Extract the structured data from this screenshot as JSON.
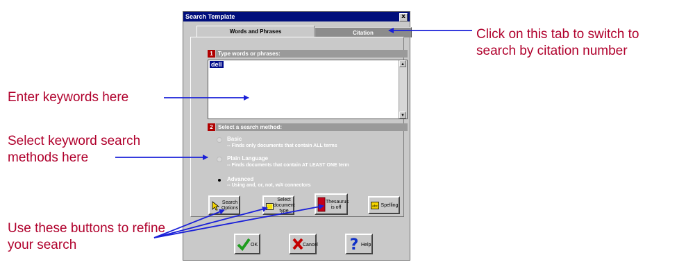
{
  "dialog": {
    "title": "Search Template",
    "close_glyph": "x",
    "tabs": [
      {
        "label": "Words and Phrases",
        "active": true
      },
      {
        "label": "Citation",
        "active": false
      }
    ],
    "section1": {
      "number": "1",
      "label": "Type words or phrases:",
      "value": "dell"
    },
    "section2": {
      "number": "2",
      "label": "Select a search method:"
    },
    "methods": [
      {
        "title": "Basic",
        "desc": "-- Finds only documents that contain ALL terms",
        "selected": false
      },
      {
        "title": "Plain Language",
        "desc": "-- Finds documents that contain AT LEAST ONE term",
        "selected": false
      },
      {
        "title": "Advanced",
        "desc": "-- Using and, or, not, w/# connectors",
        "selected": true
      }
    ],
    "tool_buttons": [
      {
        "label": "Search Options",
        "icon": "pointer-icon"
      },
      {
        "label": "Select document type",
        "icon": "document-icon"
      },
      {
        "label": "Thesaurus is off",
        "icon": "book-icon"
      },
      {
        "label": "Spelling",
        "icon": "abc-icon"
      }
    ],
    "action_buttons": [
      {
        "label": "OK",
        "icon": "check-icon"
      },
      {
        "label": "Cancel",
        "icon": "x-icon"
      },
      {
        "label": "Help",
        "icon": "question-icon"
      }
    ]
  },
  "annotations": {
    "citation_tab": "Click on this tab to switch to search by citation number",
    "keywords": "Enter keywords here",
    "methods": "Select keyword search methods here",
    "buttons": "Use these buttons to refine your search"
  },
  "colors": {
    "annotation_text": "#b0002c",
    "arrow": "#1a20d8",
    "titlebar": "#000e7c",
    "section_number": "#b00000"
  }
}
